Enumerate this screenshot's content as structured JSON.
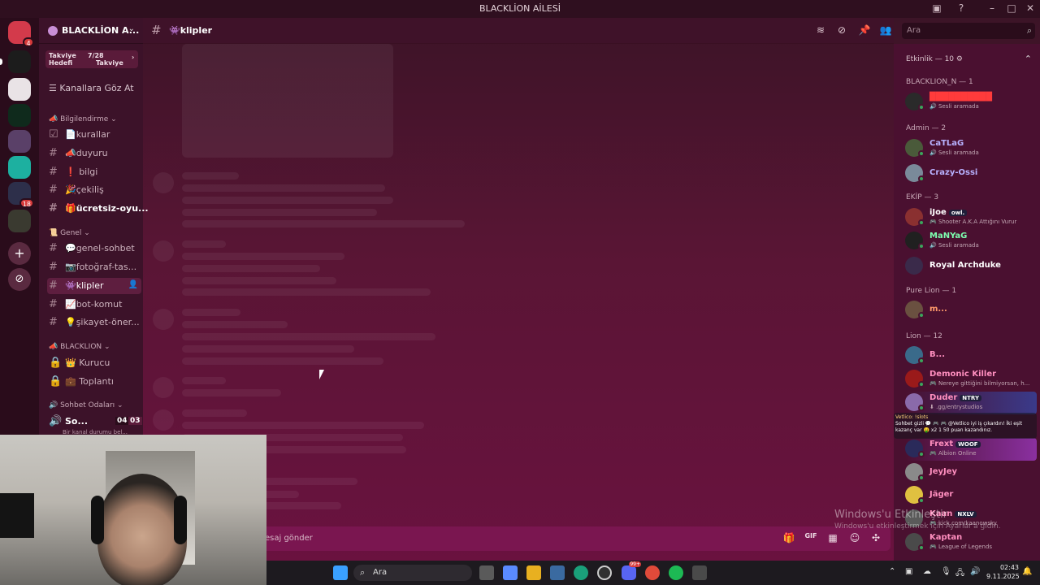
{
  "window": {
    "title": "BLACKLİON AİLESİ"
  },
  "server": {
    "name": "BLACKLİON A...",
    "boost": {
      "left": "Takviye Hedefi",
      "progress": "7/28",
      "right": "Takviye"
    },
    "browse_channels": "Kanallara Göz At"
  },
  "categories": [
    {
      "label": "Bilgilendirme",
      "channels": [
        {
          "label": "📄kurallar"
        },
        {
          "label": "📣duyuru"
        },
        {
          "label": "❗ bilgi"
        },
        {
          "label": "🎉çekiliş"
        },
        {
          "label": "🎁ücretsiz-oyu..."
        }
      ]
    },
    {
      "label": "Genel",
      "channels": [
        {
          "label": "💬genel-sohbet"
        },
        {
          "label": "📷fotoğraf-tas..."
        },
        {
          "label": "👾klipler"
        },
        {
          "label": "📈bot-komut"
        },
        {
          "label": "💡şikayet-öner..."
        }
      ]
    },
    {
      "label": "BLACKLION",
      "channels": [
        {
          "label": "👑 Kurucu"
        },
        {
          "label": "💼 Toplantı"
        }
      ]
    },
    {
      "label": "Sohbet Odaları",
      "channels": [
        {
          "label": "So...",
          "counts": [
            "04",
            "03"
          ]
        }
      ]
    }
  ],
  "voice_status": "Bir kanal durumu bel...",
  "chat": {
    "channel_name": "👾klipler",
    "composer_placeholder": "esaj gönder"
  },
  "search": {
    "placeholder": "Ara"
  },
  "members": {
    "activity_header": "Etkinlik — 10",
    "groups": [
      {
        "label": "BLACKLION_N — 1",
        "members": [
          {
            "name": "██████████",
            "status": "Sesli aramada",
            "color": "#ff3b3b"
          }
        ]
      },
      {
        "label": "Admin — 2",
        "members": [
          {
            "name": "CaTLaG",
            "status": "Sesli aramada",
            "color": "#b8b2ff"
          },
          {
            "name": "Crazy-Ossi",
            "status": "",
            "color": "#b8b2ff"
          }
        ]
      },
      {
        "label": "EKİP — 3",
        "members": [
          {
            "name": "iJoe",
            "tag": "owl.",
            "status": "Shooter A.K.A Attığını Vurur",
            "color": "#ffffff"
          },
          {
            "name": "MaNYaG",
            "status": "Sesli aramada",
            "color": "#7dffb0"
          },
          {
            "name": "Royal Archduke",
            "status": "",
            "color": "#ffffff"
          }
        ]
      },
      {
        "label": "Pure Lion — 1",
        "members": [
          {
            "name": "m...",
            "status": "",
            "color": "#ff9a6b"
          }
        ]
      },
      {
        "label": "Lion — 12",
        "members": [
          {
            "name": "B...",
            "status": "",
            "color": "#ff8fbf"
          },
          {
            "name": "Demonic Killer",
            "status": "Nereye gittiğini bilmiyorsan, h...",
            "color": "#ff8fbf"
          },
          {
            "name": "Duder",
            "tag": "NTRY",
            "status": ".gg/entrystudios",
            "color": "#ff8fbf"
          },
          {
            "name": "Frext",
            "tag": "WOOF",
            "status": "Albion Online",
            "color": "#ff8fbf"
          },
          {
            "name": "JeyJey",
            "status": "",
            "color": "#ff8fbf"
          },
          {
            "name": "Jäger",
            "status": "",
            "color": "#ff8fbf"
          },
          {
            "name": "Kaan",
            "tag": "NXLV",
            "status": "kick.com/kaanowsky",
            "color": "#ff8fbf"
          },
          {
            "name": "Kaptan",
            "status": "League of Legends",
            "color": "#ff8fbf"
          }
        ]
      }
    ]
  },
  "overlay_chat": {
    "line1": "Vetlico: !slots",
    "line2": "Sohbet gizli 💬 🎮 🎮 @Vetlico iyi iş çıkardın! İki eşit kazanç var 🤑 x2 1 50 puan kazandınız."
  },
  "windows_activation": {
    "title": "Windows'u Etkinleştir",
    "subtitle": "Windows'u etkinleştirmek için Ayarlar'a gidin."
  },
  "taskbar": {
    "search_placeholder": "Ara",
    "time": "02:43",
    "date": "9.11.2025",
    "notification_badge": "99+"
  },
  "colors": {
    "accent": "#7a1650",
    "online": "#3ba55c",
    "badge": "#d83a3a"
  }
}
